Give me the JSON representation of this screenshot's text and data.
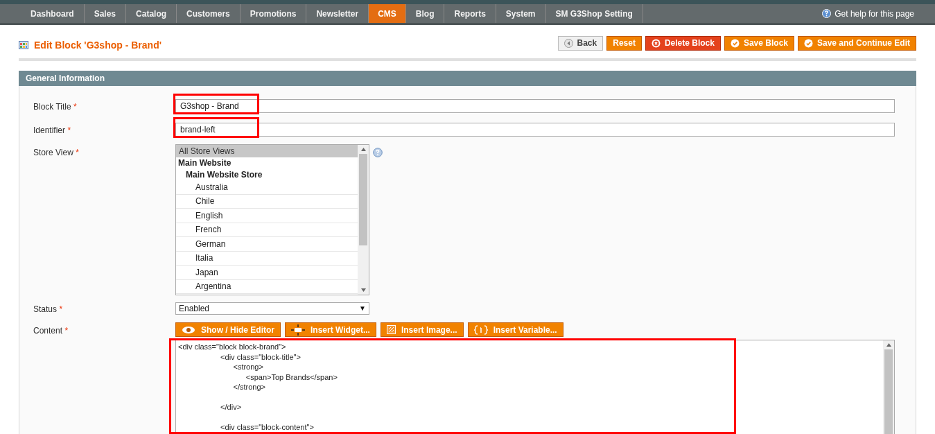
{
  "nav": {
    "items": [
      {
        "label": "Dashboard",
        "selected": false
      },
      {
        "label": "Sales",
        "selected": false
      },
      {
        "label": "Catalog",
        "selected": false
      },
      {
        "label": "Customers",
        "selected": false
      },
      {
        "label": "Promotions",
        "selected": false
      },
      {
        "label": "Newsletter",
        "selected": false
      },
      {
        "label": "CMS",
        "selected": true
      },
      {
        "label": "Blog",
        "selected": false
      },
      {
        "label": "Reports",
        "selected": false
      },
      {
        "label": "System",
        "selected": false
      },
      {
        "label": "SM G3Shop Setting",
        "selected": false
      }
    ],
    "help": "Get help for this page"
  },
  "page_title": "Edit Block 'G3shop - Brand'",
  "actions": [
    {
      "label": "Back",
      "kind": "back"
    },
    {
      "label": "Reset",
      "kind": "plain"
    },
    {
      "label": "Delete Block",
      "kind": "delete"
    },
    {
      "label": "Save Block",
      "kind": "save"
    },
    {
      "label": "Save and Continue Edit",
      "kind": "save"
    }
  ],
  "section": {
    "title": "General Information"
  },
  "fields": {
    "block_title": {
      "label": "Block Title",
      "required": "*",
      "value": "G3shop - Brand",
      "highlighted": true
    },
    "identifier": {
      "label": "Identifier",
      "required": "*",
      "value": "brand-left",
      "highlighted": true
    },
    "store_view": {
      "label": "Store View",
      "required": "*",
      "options": [
        {
          "label": "All Store Views",
          "kind": "option",
          "selected": true
        },
        {
          "label": "Main Website",
          "kind": "group",
          "selected": false
        },
        {
          "label": "Main Website Store",
          "kind": "subgroup",
          "selected": false
        },
        {
          "label": "Australia",
          "kind": "option",
          "selected": false
        },
        {
          "label": "Chile",
          "kind": "option",
          "selected": false
        },
        {
          "label": "English",
          "kind": "option",
          "selected": false
        },
        {
          "label": "French",
          "kind": "option",
          "selected": false
        },
        {
          "label": "German",
          "kind": "option",
          "selected": false
        },
        {
          "label": "Italia",
          "kind": "option",
          "selected": false
        },
        {
          "label": "Japan",
          "kind": "option",
          "selected": false
        },
        {
          "label": "Argentina",
          "kind": "option",
          "selected": false
        }
      ]
    },
    "status": {
      "label": "Status",
      "required": "*",
      "value": "Enabled",
      "arrow": "▼"
    },
    "content": {
      "label": "Content",
      "required": "*",
      "highlighted": true,
      "tools": [
        {
          "label": "Show / Hide Editor",
          "kind": "eye"
        },
        {
          "label": "Insert Widget...",
          "kind": "widget"
        },
        {
          "label": "Insert Image...",
          "kind": "image"
        },
        {
          "label": "Insert Variable...",
          "kind": "variable"
        }
      ],
      "paragraphs": [
        [
          "<div class=\"block block-brand\">",
          "                    <div class=\"block-title\">",
          "                          <strong>",
          "                                <span>Top Brands</span>",
          "                          </strong>"
        ],
        [
          "                    </div>"
        ],
        [
          "                    <div class=\"block-content\">"
        ]
      ]
    }
  }
}
